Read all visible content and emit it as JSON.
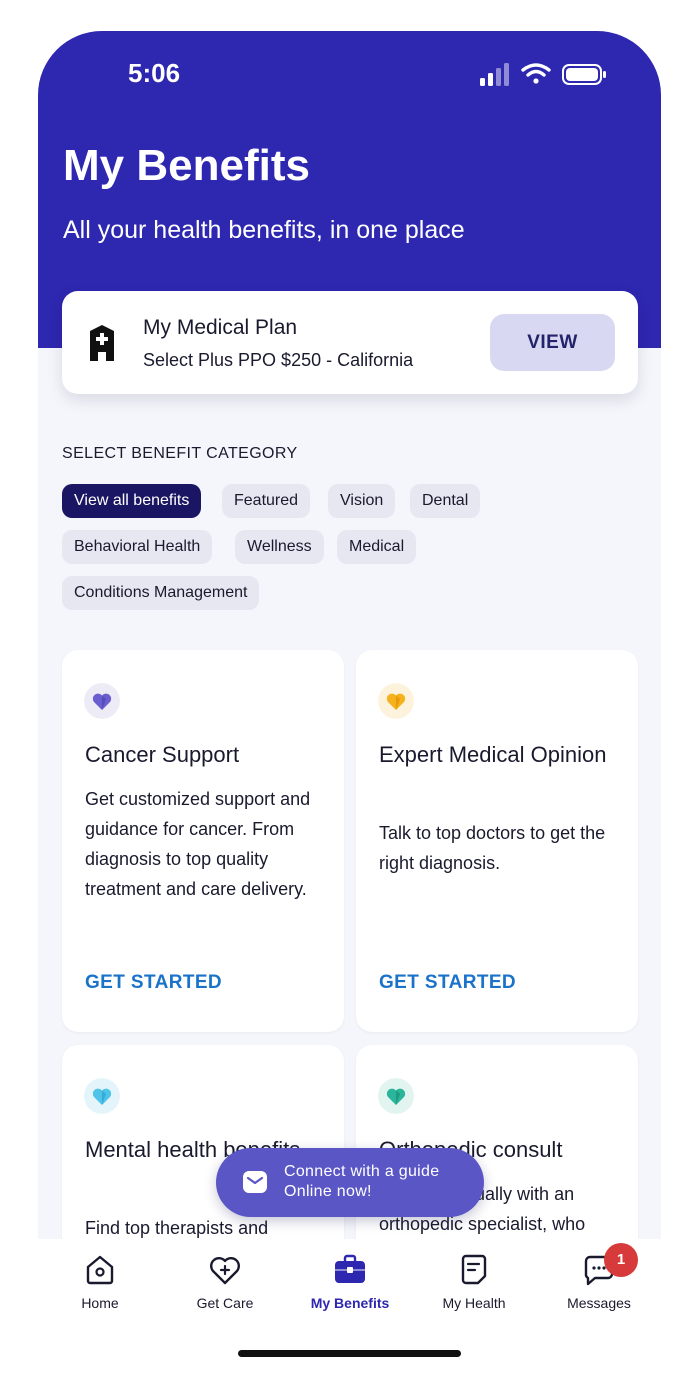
{
  "status_bar": {
    "time": "5:06"
  },
  "header": {
    "title": "My Benefits",
    "subtitle": "All your health benefits, in one place"
  },
  "plan": {
    "title": "My Medical Plan",
    "subtitle": "Select Plus PPO $250 - California",
    "button": "VIEW",
    "icon": "hospital-icon"
  },
  "categories": {
    "label": "SELECT BENEFIT CATEGORY",
    "chips": [
      "View all benefits",
      "Featured",
      "Vision",
      "Dental",
      "Behavioral Health",
      "Wellness",
      "Medical",
      "Conditions Management"
    ],
    "selected": "View all benefits"
  },
  "cards": [
    {
      "title": "Cancer Support",
      "description": "Get customized support and guidance for cancer. From diagnosis to top quality treatment and care delivery.",
      "cta": "GET STARTED",
      "icon": "heart-purple-icon",
      "icon_color": "#6b5fd0"
    },
    {
      "title": "Expert Medical Opinion",
      "description": "Talk to top doctors to get the right diagnosis.",
      "cta": "GET STARTED",
      "icon": "heart-yellow-icon",
      "icon_color": "#f5b21c"
    },
    {
      "title": "Mental health benefits",
      "description": "Find top therapists and",
      "icon": "heart-blue-icon",
      "icon_color": "#4fc3e8"
    },
    {
      "title": "Orthopedic consult",
      "description": "Connect virtually with an orthopedic specialist, who",
      "icon": "heart-teal-icon",
      "icon_color": "#2bb59a"
    }
  ],
  "guide": {
    "line1": "Connect with a guide",
    "line2": "Online now!",
    "icon": "message-icon"
  },
  "tabbar": {
    "items": [
      {
        "label": "Home",
        "icon": "home-icon"
      },
      {
        "label": "Get Care",
        "icon": "heart-plus-icon"
      },
      {
        "label": "My Benefits",
        "icon": "briefcase-icon"
      },
      {
        "label": "My Health",
        "icon": "document-icon"
      },
      {
        "label": "Messages",
        "icon": "chat-icon"
      }
    ],
    "active": "My Benefits",
    "messages_badge": "1"
  },
  "colors": {
    "brand": "#2e27b0",
    "accent": "#1a73c9",
    "badge": "#d73a3a"
  }
}
